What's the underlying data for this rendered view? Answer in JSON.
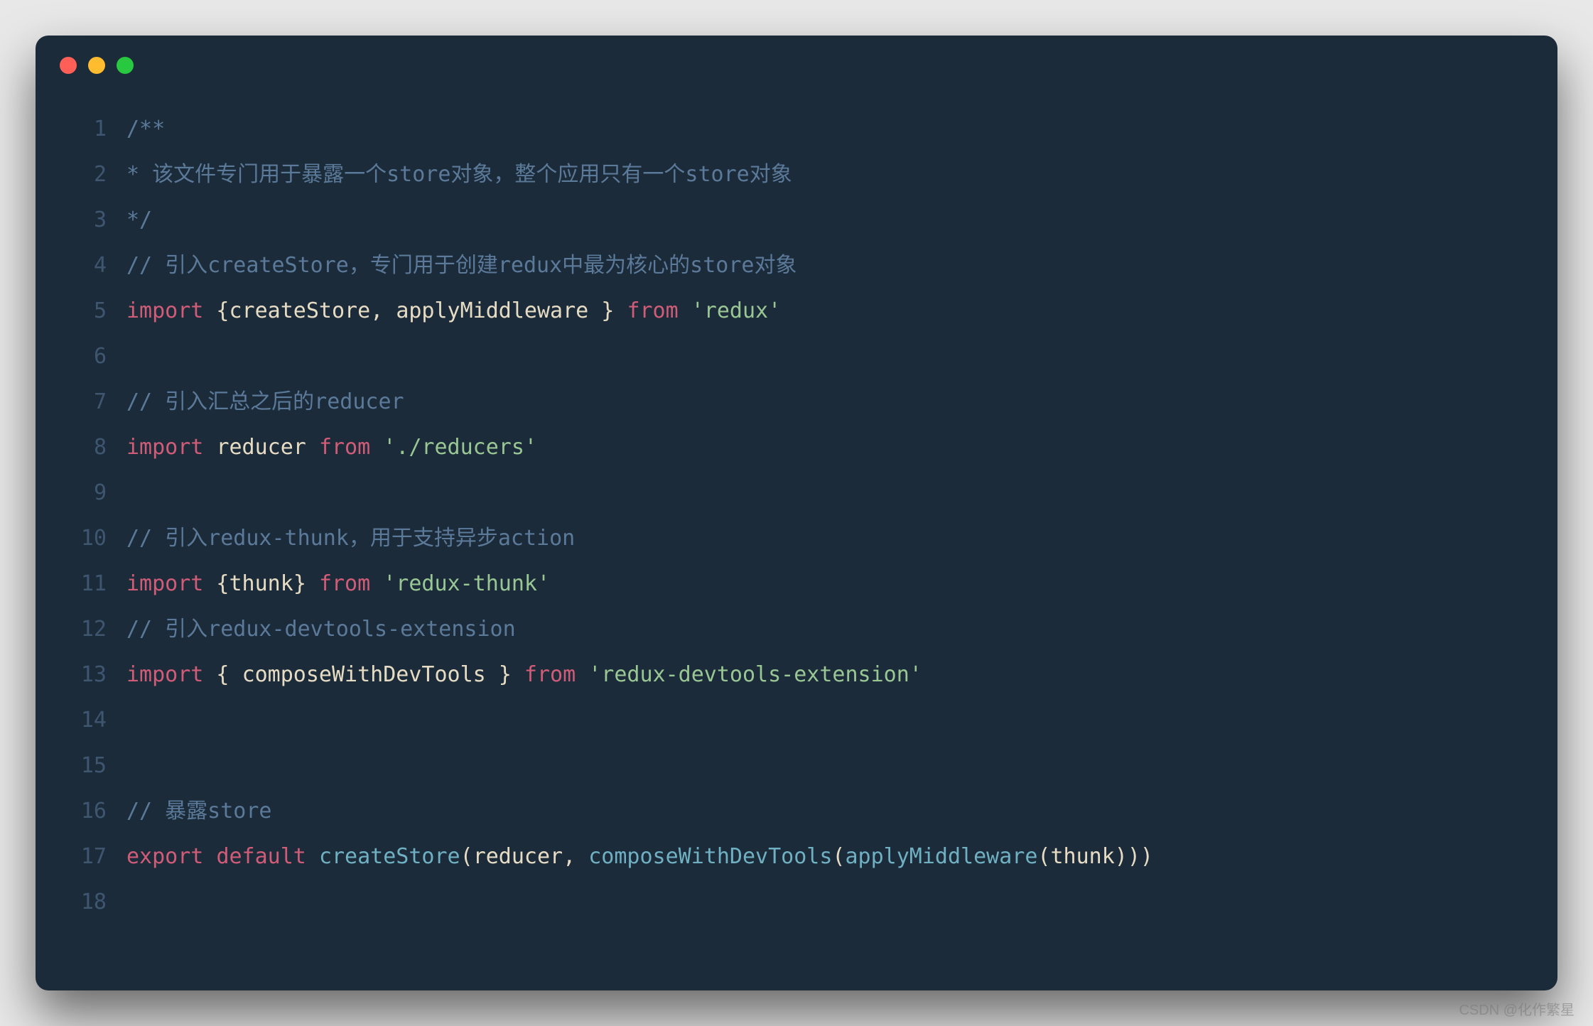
{
  "window": {
    "traffic_light_colors": {
      "close": "#ff5f57",
      "min": "#febc2e",
      "max": "#28c840"
    }
  },
  "watermark": "CSDN @化作繁星",
  "lines": [
    {
      "n": "1",
      "tokens": [
        {
          "cls": "c-comment",
          "t": "/**"
        }
      ]
    },
    {
      "n": "2",
      "tokens": [
        {
          "cls": "c-comment",
          "t": "* 该文件专门用于暴露一个store对象，整个应用只有一个store对象"
        }
      ]
    },
    {
      "n": "3",
      "tokens": [
        {
          "cls": "c-comment",
          "t": "*/"
        }
      ]
    },
    {
      "n": "4",
      "tokens": [
        {
          "cls": "c-comment",
          "t": "// 引入createStore，专门用于创建redux中最为核心的store对象"
        }
      ]
    },
    {
      "n": "5",
      "tokens": [
        {
          "cls": "c-keyword",
          "t": "import"
        },
        {
          "cls": "c-punc",
          "t": " {"
        },
        {
          "cls": "c-ident",
          "t": "createStore"
        },
        {
          "cls": "c-punc",
          "t": ", "
        },
        {
          "cls": "c-ident",
          "t": "applyMiddleware"
        },
        {
          "cls": "c-punc",
          "t": " } "
        },
        {
          "cls": "c-keyword",
          "t": "from"
        },
        {
          "cls": "c-punc",
          "t": " "
        },
        {
          "cls": "c-string",
          "t": "'redux'"
        }
      ]
    },
    {
      "n": "6",
      "tokens": []
    },
    {
      "n": "7",
      "tokens": [
        {
          "cls": "c-comment",
          "t": "// 引入汇总之后的reducer"
        }
      ]
    },
    {
      "n": "8",
      "tokens": [
        {
          "cls": "c-keyword",
          "t": "import"
        },
        {
          "cls": "c-punc",
          "t": " "
        },
        {
          "cls": "c-ident",
          "t": "reducer"
        },
        {
          "cls": "c-punc",
          "t": " "
        },
        {
          "cls": "c-keyword",
          "t": "from"
        },
        {
          "cls": "c-punc",
          "t": " "
        },
        {
          "cls": "c-string",
          "t": "'./reducers'"
        }
      ]
    },
    {
      "n": "9",
      "tokens": []
    },
    {
      "n": "10",
      "tokens": [
        {
          "cls": "c-comment",
          "t": "// 引入redux-thunk，用于支持异步action"
        }
      ]
    },
    {
      "n": "11",
      "tokens": [
        {
          "cls": "c-keyword",
          "t": "import"
        },
        {
          "cls": "c-punc",
          "t": " {"
        },
        {
          "cls": "c-ident",
          "t": "thunk"
        },
        {
          "cls": "c-punc",
          "t": "} "
        },
        {
          "cls": "c-keyword",
          "t": "from"
        },
        {
          "cls": "c-punc",
          "t": " "
        },
        {
          "cls": "c-string",
          "t": "'redux-thunk'"
        }
      ]
    },
    {
      "n": "12",
      "tokens": [
        {
          "cls": "c-comment",
          "t": "// 引入redux-devtools-extension"
        }
      ]
    },
    {
      "n": "13",
      "tokens": [
        {
          "cls": "c-keyword",
          "t": "import"
        },
        {
          "cls": "c-punc",
          "t": " { "
        },
        {
          "cls": "c-ident",
          "t": "composeWithDevTools"
        },
        {
          "cls": "c-punc",
          "t": " } "
        },
        {
          "cls": "c-keyword",
          "t": "from"
        },
        {
          "cls": "c-punc",
          "t": " "
        },
        {
          "cls": "c-string",
          "t": "'redux-devtools-extension'"
        }
      ]
    },
    {
      "n": "14",
      "tokens": []
    },
    {
      "n": "15",
      "tokens": []
    },
    {
      "n": "16",
      "tokens": [
        {
          "cls": "c-comment",
          "t": "// 暴露store"
        }
      ]
    },
    {
      "n": "17",
      "tokens": [
        {
          "cls": "c-keyword",
          "t": "export"
        },
        {
          "cls": "c-punc",
          "t": " "
        },
        {
          "cls": "c-keyword",
          "t": "default"
        },
        {
          "cls": "c-punc",
          "t": " "
        },
        {
          "cls": "c-func",
          "t": "createStore"
        },
        {
          "cls": "c-punc",
          "t": "("
        },
        {
          "cls": "c-ident",
          "t": "reducer"
        },
        {
          "cls": "c-punc",
          "t": ", "
        },
        {
          "cls": "c-func",
          "t": "composeWithDevTools"
        },
        {
          "cls": "c-punc",
          "t": "("
        },
        {
          "cls": "c-func",
          "t": "applyMiddleware"
        },
        {
          "cls": "c-punc",
          "t": "("
        },
        {
          "cls": "c-ident",
          "t": "thunk"
        },
        {
          "cls": "c-punc",
          "t": ")))"
        }
      ]
    },
    {
      "n": "18",
      "tokens": []
    }
  ]
}
